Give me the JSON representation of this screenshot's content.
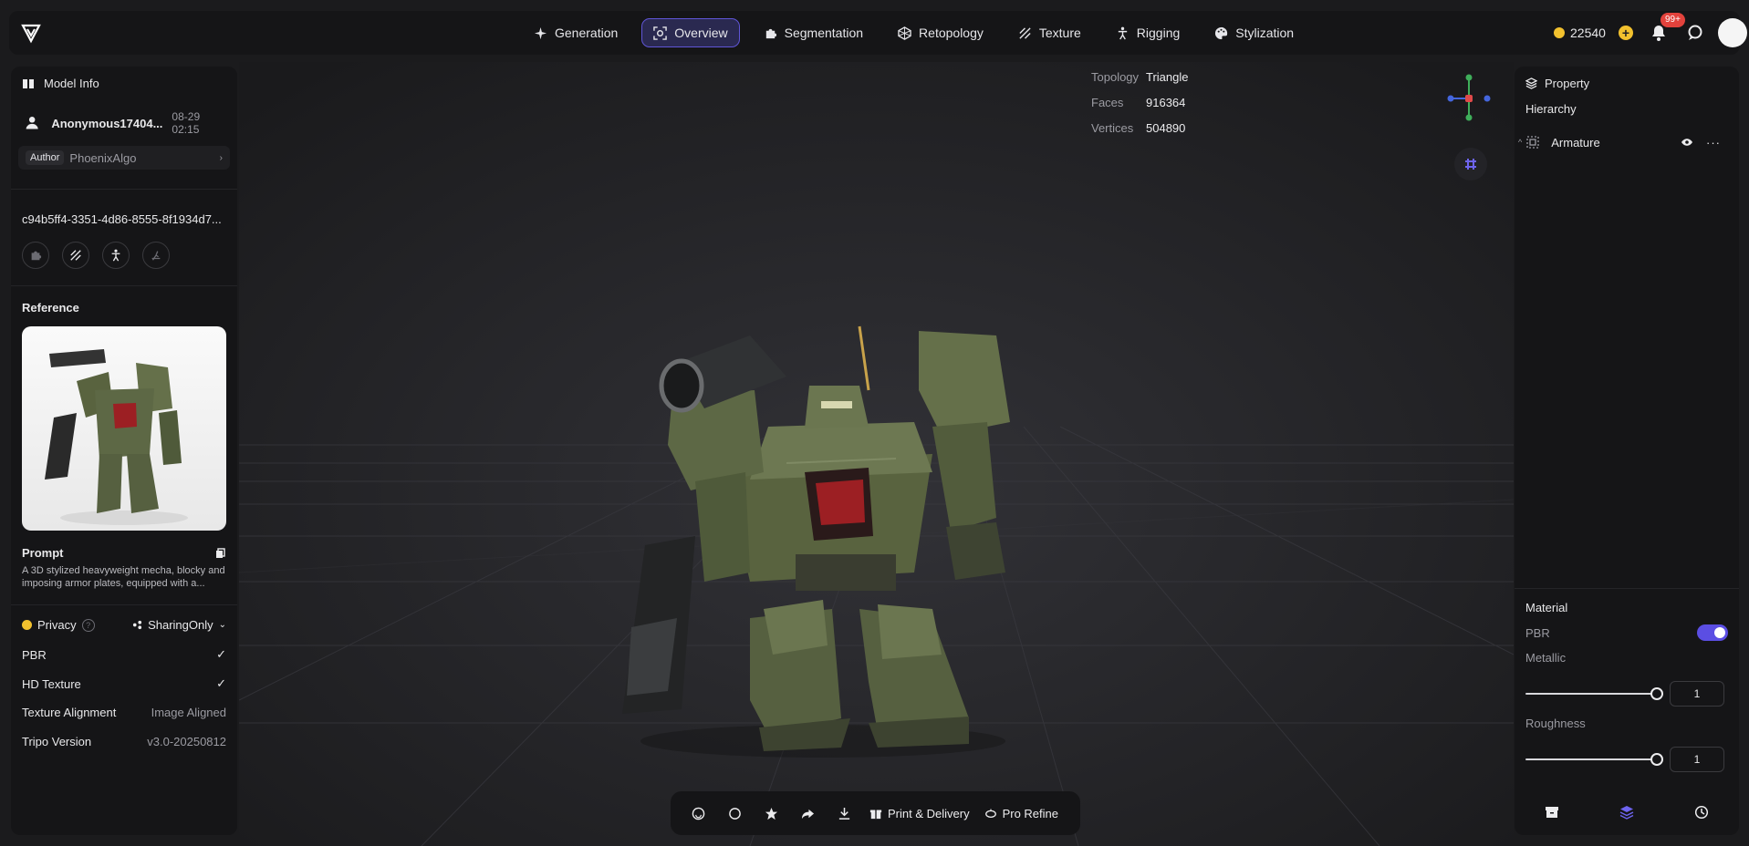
{
  "topbar": {
    "tabs": [
      {
        "label": "Generation",
        "icon": "sparkle-icon",
        "active": false
      },
      {
        "label": "Overview",
        "icon": "scan-icon",
        "active": true
      },
      {
        "label": "Segmentation",
        "icon": "puzzle-icon",
        "active": false
      },
      {
        "label": "Retopology",
        "icon": "mesh-icon",
        "active": false
      },
      {
        "label": "Texture",
        "icon": "texture-icon",
        "active": false
      },
      {
        "label": "Rigging",
        "icon": "person-icon",
        "active": false
      },
      {
        "label": "Stylization",
        "icon": "palette-icon",
        "active": false
      }
    ],
    "credits": "22540",
    "notif_badge": "99+"
  },
  "left_panel": {
    "title": "Model Info",
    "user_name": "Anonymous17404...",
    "date": "08-29 02:15",
    "author_badge": "Author",
    "author_name": "PhoenixAlgo",
    "model_id": "c94b5ff4-3351-4d86-8555-8f1934d7...",
    "reference_label": "Reference",
    "prompt_label": "Prompt",
    "prompt_text": "A 3D stylized heavyweight mecha, blocky and imposing armor plates, equipped with a...",
    "privacy_label": "Privacy",
    "privacy_value": "SharingOnly",
    "props": [
      {
        "key": "PBR",
        "value": "✓"
      },
      {
        "key": "HD Texture",
        "value": "✓"
      },
      {
        "key": "Texture Alignment",
        "value": "Image Aligned"
      },
      {
        "key": "Tripo Version",
        "value": "v3.0-20250812"
      }
    ]
  },
  "viewport": {
    "stats": [
      {
        "key": "Topology",
        "value": "Triangle"
      },
      {
        "key": "Faces",
        "value": "916364"
      },
      {
        "key": "Vertices",
        "value": "504890"
      }
    ]
  },
  "bottombar": {
    "print_label": "Print & Delivery",
    "refine_label": "Pro Refine"
  },
  "right_panel": {
    "title": "Property",
    "hierarchy_label": "Hierarchy",
    "armature_label": "Armature",
    "material_label": "Material",
    "pbr_label": "PBR",
    "metallic_label": "Metallic",
    "metallic_value": "1",
    "roughness_label": "Roughness",
    "roughness_value": "1"
  }
}
